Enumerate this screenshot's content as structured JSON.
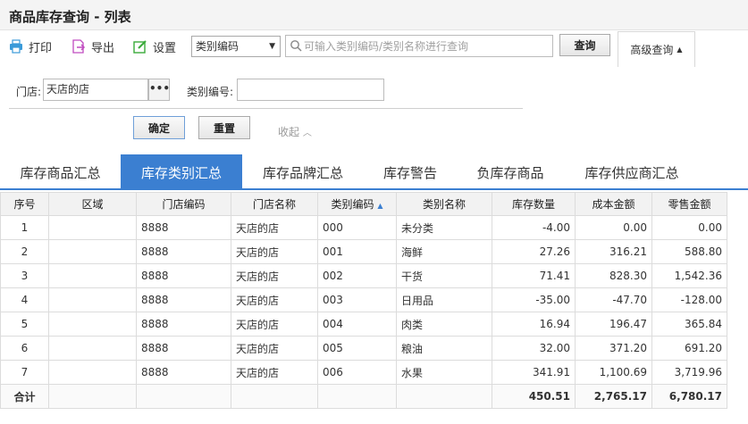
{
  "window": {
    "title": "商品库存查询 - 列表"
  },
  "toolbar": {
    "print_label": "打印",
    "export_label": "导出",
    "settings_label": "设置",
    "select_value": "类别编码",
    "search_placeholder": "可输入类别编码/类别名称进行查询",
    "query_label": "查询",
    "advanced_label": "高级查询"
  },
  "filters": {
    "store_label": "门店:",
    "store_value": "天店的店",
    "category_label": "类别编号:",
    "category_value": "",
    "confirm_label": "确定",
    "reset_label": "重置",
    "collapse_label": "收起"
  },
  "tabs": [
    "库存商品汇总",
    "库存类别汇总",
    "库存品牌汇总",
    "库存警告",
    "负库存商品",
    "库存供应商汇总"
  ],
  "active_tab": 1,
  "table": {
    "headers": [
      "序号",
      "区域",
      "门店编码",
      "门店名称",
      "类别编码",
      "类别名称",
      "库存数量",
      "成本金额",
      "零售金额"
    ],
    "rows": [
      [
        "1",
        "",
        "8888",
        "天店的店",
        "000",
        "未分类",
        "-4.00",
        "0.00",
        "0.00"
      ],
      [
        "2",
        "",
        "8888",
        "天店的店",
        "001",
        "海鲜",
        "27.26",
        "316.21",
        "588.80"
      ],
      [
        "3",
        "",
        "8888",
        "天店的店",
        "002",
        "干货",
        "71.41",
        "828.30",
        "1,542.36"
      ],
      [
        "4",
        "",
        "8888",
        "天店的店",
        "003",
        "日用品",
        "-35.00",
        "-47.70",
        "-128.00"
      ],
      [
        "5",
        "",
        "8888",
        "天店的店",
        "004",
        "肉类",
        "16.94",
        "196.47",
        "365.84"
      ],
      [
        "6",
        "",
        "8888",
        "天店的店",
        "005",
        "粮油",
        "32.00",
        "371.20",
        "691.20"
      ],
      [
        "7",
        "",
        "8888",
        "天店的店",
        "006",
        "水果",
        "341.91",
        "1,100.69",
        "3,719.96"
      ]
    ],
    "total_label": "合计",
    "totals": [
      "450.51",
      "2,765.17",
      "6,780.17"
    ]
  },
  "colors": {
    "accent": "#3b7fd1",
    "header_bg": "#f2f2f2"
  }
}
